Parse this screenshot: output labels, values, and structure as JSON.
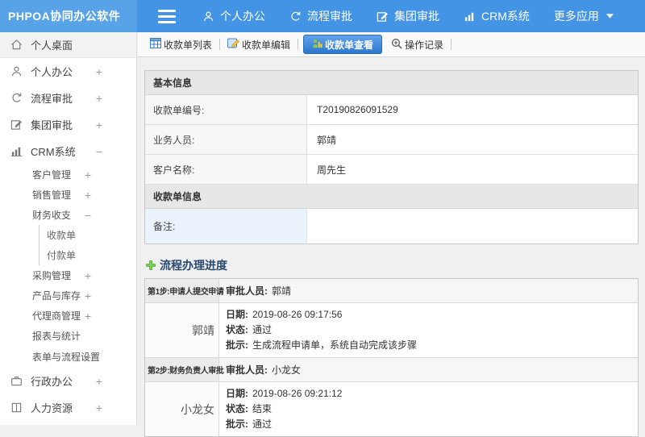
{
  "header": {
    "app_title": "PHPOA协同办公软件",
    "nav": [
      {
        "label": "个人办公",
        "icon": "user-icon"
      },
      {
        "label": "流程审批",
        "icon": "flow-icon"
      },
      {
        "label": "集团审批",
        "icon": "edit-icon"
      },
      {
        "label": "CRM系统",
        "icon": "chart-icon"
      },
      {
        "label": "更多应用",
        "icon": "caret-down-icon"
      }
    ]
  },
  "sidebar": {
    "items": [
      {
        "label": "个人桌面",
        "icon": "home-icon",
        "level": 1,
        "active": true
      },
      {
        "label": "个人办公",
        "icon": "user-icon",
        "level": 1,
        "expand": "+"
      },
      {
        "label": "流程审批",
        "icon": "flow-icon",
        "level": 1,
        "expand": "+"
      },
      {
        "label": "集团审批",
        "icon": "edit-icon",
        "level": 1,
        "expand": "+"
      },
      {
        "label": "CRM系统",
        "icon": "chart-icon",
        "level": 1,
        "expand": "−"
      },
      {
        "label": "客户管理",
        "level": 2,
        "expand": "+"
      },
      {
        "label": "销售管理",
        "level": 2,
        "expand": "+"
      },
      {
        "label": "财务收支",
        "level": 2,
        "expand": "−"
      },
      {
        "label": "收款单",
        "level": 3
      },
      {
        "label": "付款单",
        "level": 3
      },
      {
        "label": "采购管理",
        "level": 2,
        "expand": "+"
      },
      {
        "label": "产品与库存",
        "level": 2,
        "expand": "+"
      },
      {
        "label": "代理商管理",
        "level": 2,
        "expand": "+"
      },
      {
        "label": "报表与统计",
        "level": 2
      },
      {
        "label": "表单与流程设置",
        "level": 2,
        "expand": "+"
      },
      {
        "label": "行政办公",
        "icon": "briefcase-icon",
        "level": 1,
        "expand": "+"
      },
      {
        "label": "人力资源",
        "icon": "book-icon",
        "level": 1,
        "expand": "+"
      }
    ]
  },
  "tabs": [
    {
      "label": "收款单列表",
      "icon": "table-icon",
      "active": false
    },
    {
      "label": "收款单编辑",
      "icon": "edit-doc-icon",
      "active": false
    },
    {
      "label": "收款单查看",
      "icon": "view-icon",
      "active": true
    },
    {
      "label": "操作记录",
      "icon": "zoom-icon",
      "active": false
    }
  ],
  "form": {
    "sections": [
      {
        "title": "基本信息",
        "rows": [
          {
            "label": "收款单编号:",
            "value": "T20190826091529"
          },
          {
            "label": "业务人员:",
            "value": "郭靖"
          },
          {
            "label": "客户名称:",
            "value": "周先生"
          }
        ]
      },
      {
        "title": "收款单信息",
        "rows": [
          {
            "label": "备注:",
            "value": ""
          }
        ]
      }
    ]
  },
  "process": {
    "title": "流程办理进度",
    "labels": {
      "approver": "审批人员:",
      "date": "日期:",
      "status": "状态:",
      "comment": "批示:"
    },
    "steps": [
      {
        "step": "第1步:申请人提交申请",
        "approver": "郭靖",
        "name": "郭靖",
        "date": "2019-08-26 09:17:56",
        "status": "通过",
        "comment": "生成流程申请单，系统自动完成该步骤"
      },
      {
        "step": "第2步:财务负责人审批",
        "approver": "小龙女",
        "name": "小龙女",
        "date": "2019-08-26 09:21:12",
        "status": "结束",
        "comment": "通过"
      }
    ]
  },
  "colors": {
    "header_bar": "#4394e4",
    "logo_bg": "#58a3e8",
    "active_tab_top": "#60a3ec",
    "active_tab_bottom": "#2b78cd",
    "note_label_bg": "#eaf3fb",
    "plus_green": "#55b43c"
  }
}
